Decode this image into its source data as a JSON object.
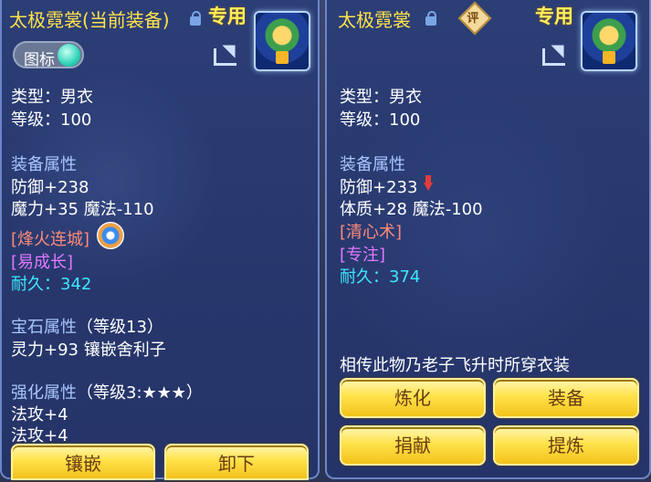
{
  "left": {
    "title": "太极霓裳",
    "title_suffix": "(当前装备)",
    "exclusive": "专用",
    "toggle_label": "图标",
    "type": "类型：男衣",
    "level": "等级：100",
    "equip_attr_header": "装备属性",
    "defense": "防御+238",
    "magic": "魔力+35 魔法-110",
    "skill_effect": "[烽火连城]",
    "special_effect": "[易成长]",
    "durability_label": "耐久：",
    "durability_value": "342",
    "gem_header": "宝石属性",
    "gem_level": "（等级13）",
    "gem_stats": "灵力+93 镶嵌舍利子",
    "enhance_header": "强化属性",
    "enhance_level": "（等级3:★★★）",
    "enhance_stat1": "法攻+4",
    "enhance_stat2": "法攻+4",
    "buttons": {
      "inlay": "镶嵌",
      "unequip": "卸下"
    }
  },
  "right": {
    "title": "太极霓裳",
    "rate_badge": "评",
    "exclusive": "专用",
    "type": "类型：男衣",
    "level": "等级：100",
    "equip_attr_header": "装备属性",
    "defense": "防御+233",
    "constitution": "体质+28 魔法-100",
    "skill_effect": "[清心术]",
    "special_effect": "[专注]",
    "durability_label": "耐久：",
    "durability_value": "374",
    "description": "相传此物乃老子飞升时所穿衣装",
    "buttons": {
      "refine": "炼化",
      "equip": "装备",
      "donate": "捐献",
      "extract": "提炼"
    }
  },
  "icons": [
    "lock-icon",
    "share-icon",
    "equipment-item-icon",
    "skill-swirl-icon",
    "down-arrow-icon",
    "rate-badge-icon",
    "toggle-knob-icon"
  ]
}
